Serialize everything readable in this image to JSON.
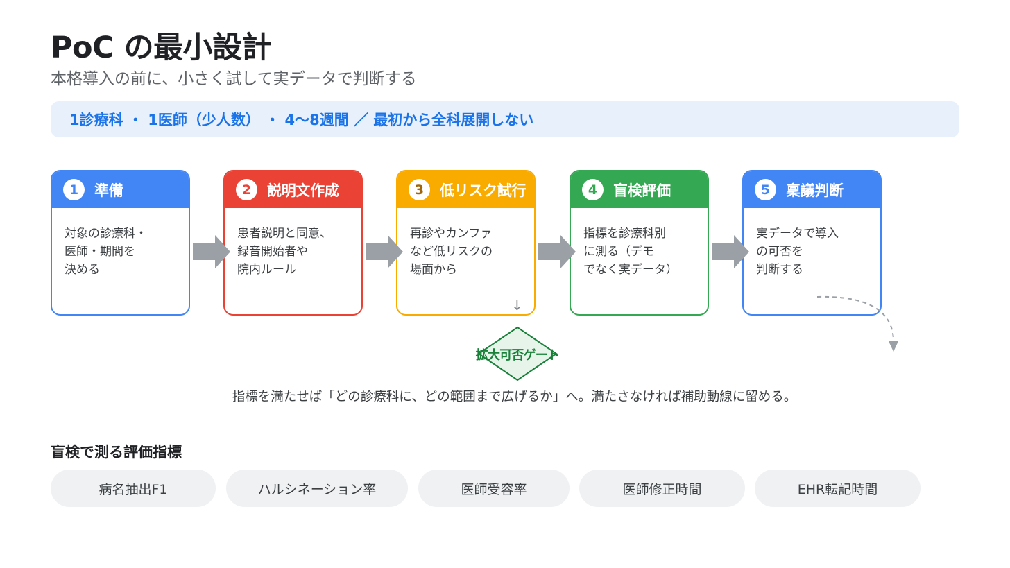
{
  "header": {
    "title": "PoC の最小設計",
    "subtitle": "本格導入の前に、小さく試して実データで判断する"
  },
  "banner": {
    "text": "1診療科 ・ 1医師（少人数） ・ 4〜8週間 ／ 最初から全科展開しない"
  },
  "steps": [
    {
      "number": "1",
      "label": "準備",
      "lines": [
        "対象の診療科・",
        "医師・期間を",
        "決める"
      ]
    },
    {
      "number": "2",
      "label": "説明文作成",
      "lines": [
        "患者説明と同意、",
        "録音開始者や",
        "院内ルール"
      ]
    },
    {
      "number": "3",
      "label": "低リスク試行",
      "lines": [
        "再診やカンファ",
        "など低リスクの",
        "場面から"
      ]
    },
    {
      "number": "4",
      "label": "盲検評価",
      "lines": [
        "指標を診療科別",
        "に測る（デモ",
        "でなく実データ）"
      ]
    },
    {
      "number": "5",
      "label": "稟議判断",
      "lines": [
        "実データで導入",
        "の可否を",
        "判断する"
      ]
    }
  ],
  "gate": {
    "label": "拡大可否ゲート",
    "arrow_glyph": "↓"
  },
  "note": "指標を満たせば「どの診療科に、どの範囲まで広げるか」へ。満たさなければ補助動線に留める。",
  "metrics": {
    "heading": "盲検で測る評価指標",
    "items": [
      "病名抽出F1",
      "ハルシネーション率",
      "医師受容率",
      "医師修正時間",
      "EHR転記時間"
    ]
  },
  "colors": {
    "blue": "#4285f4",
    "red": "#ea4335",
    "yellow": "#f9ab00",
    "green": "#34a853",
    "banner_bg": "#e8f0fc",
    "banner_text": "#1a73e8",
    "gate_green": "#188038",
    "pill_bg": "#eff1f3",
    "arrow_gray": "#9aa0a6"
  }
}
